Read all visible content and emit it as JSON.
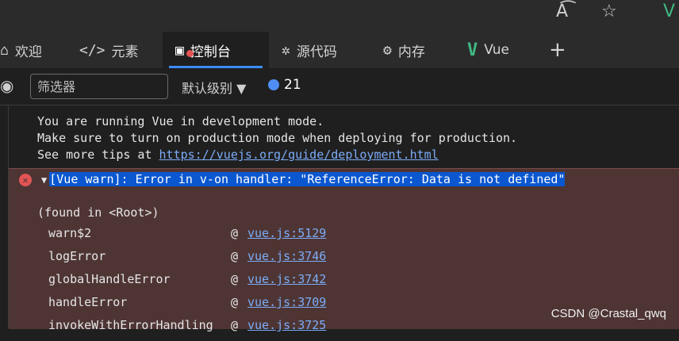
{
  "browser": {
    "read_aloud_icon": "read-aloud-icon",
    "favorite_icon": "star-icon",
    "vue_icon": "vue-logo-icon"
  },
  "tabs": [
    {
      "label": "欢迎",
      "icon": "home-icon",
      "active": false
    },
    {
      "label": "元素",
      "icon": "code-icon",
      "active": false
    },
    {
      "label": "控制台",
      "icon": "console-icon",
      "active": true
    },
    {
      "label": "源代码",
      "icon": "bug-icon",
      "active": false
    },
    {
      "label": "内存",
      "icon": "memory-chip-icon",
      "active": false
    },
    {
      "label": "Vue",
      "icon": "vue-logo-icon",
      "active": false
    }
  ],
  "add_tab_label": "+",
  "toolbar": {
    "filter_placeholder": "筛选器",
    "level_label": "默认级别 ▼",
    "message_count": "21"
  },
  "console": {
    "info_lines": [
      "You are running Vue in development mode.",
      "Make sure to turn on production mode when deploying for production.",
      "See more tips at "
    ],
    "info_link": "https://vuejs.org/guide/deployment.html",
    "error": {
      "title": "[Vue warn]: Error in v-on handler: \"ReferenceError: Data is not defined\"",
      "found": "(found in <Root>)",
      "stack": [
        {
          "fn": "warn$2",
          "loc": "vue.js:5129"
        },
        {
          "fn": "logError",
          "loc": "vue.js:3746"
        },
        {
          "fn": "globalHandleError",
          "loc": "vue.js:3742"
        },
        {
          "fn": "handleError",
          "loc": "vue.js:3709"
        },
        {
          "fn": "invokeWithErrorHandling",
          "loc": "vue.js:3725"
        }
      ]
    }
  },
  "watermark": "CSDN @Crastal_qwq",
  "colors": {
    "accent": "#3c8cff",
    "error_bg": "#4e3534",
    "link": "#7cacf8",
    "selection": "#0a57d0"
  }
}
